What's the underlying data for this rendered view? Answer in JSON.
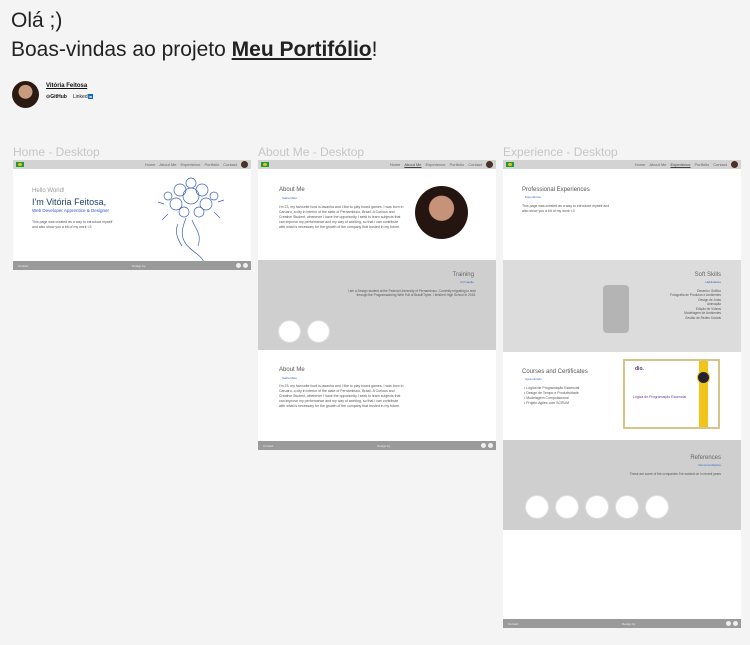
{
  "header": {
    "greeting": "Olá  ;)",
    "welcome_prefix": "Boas-vindas ao projeto ",
    "project_name": "Meu Portifólio",
    "welcome_suffix": "!"
  },
  "author": {
    "name": "Vitória Feitosa",
    "github_label": "GitHub",
    "linkedin_label": "Linked",
    "linkedin_badge": "in"
  },
  "frames": [
    {
      "label": "Home - Desktop"
    },
    {
      "label": "About Me - Desktop"
    },
    {
      "label": "Experience - Desktop"
    }
  ],
  "nav": {
    "links": [
      "Home",
      "About Me",
      "Experience",
      "Portfolio",
      "Contact"
    ]
  },
  "home": {
    "hello": "Hello World!",
    "name": "I'm Vitória Feitosa,",
    "role": "Web Developer Apprentice & Designer",
    "intro": "This page was created as a way to introduce myself and also show you a bit of my work <3"
  },
  "about": {
    "title": "About Me",
    "subtitle": "Saiba Mais",
    "text": "I'm 23, my favourite food is lasanha and I like to play board games. I was born in Caruaru, a city in interior of the state of Pernambuco, Brazil. A Curious and Creative Student, whenever I have the opportunity I seek to learn subjects that can improve my performance and my way of working, so that I can contribute with what is necessary for the growth of the company that trusted in my future.",
    "training_title": "Training",
    "training_sub": "Formação",
    "training_text": "I am a Design student at the Federal University of Pernambuco. Currently migrating to tech through the Programadoring Web Full of Brasil/Trybe. I finished High School in 2016.",
    "title2": "About Me",
    "subtitle2": "Saiba Mais"
  },
  "experience": {
    "title": "Professional Experiences",
    "subtitle": "Experiência",
    "intro": "This page was created as a way to introduce myself and also show you a bit of my work <3",
    "skills_title": "Soft Skills",
    "skills_sub": "Habilidades",
    "skills": [
      "Desenho Gráfico",
      "Fotografia de Produtos e Ambientes",
      "Design de Joias",
      "Animação",
      "Edição de Vídeos",
      "Modelagem de Ambientes",
      "Gestão de Redes Sociais"
    ],
    "courses_title": "Courses and Certificates",
    "courses_sub": "Aprendizado",
    "courses": [
      "Lógica de Programação Essencial",
      "Design de Tempo e Produtividade",
      "Modelagem Computacional",
      "Projeto Agiles com SCRUM"
    ],
    "cert_logo": "dio.",
    "cert_title": "Lógica de Programação Essencial",
    "refs_title": "References",
    "refs_sub": "Recomendações",
    "refs_text": "These are some of the companies I've worked on in recent years"
  },
  "footer": {
    "left": "Contact",
    "center": "Design by"
  },
  "colors": {
    "accent_blue": "#2a56c6",
    "name_navy": "#1e3e6e",
    "band_gray": "#cfcfcf",
    "footer_gray": "#9a9a9a"
  }
}
